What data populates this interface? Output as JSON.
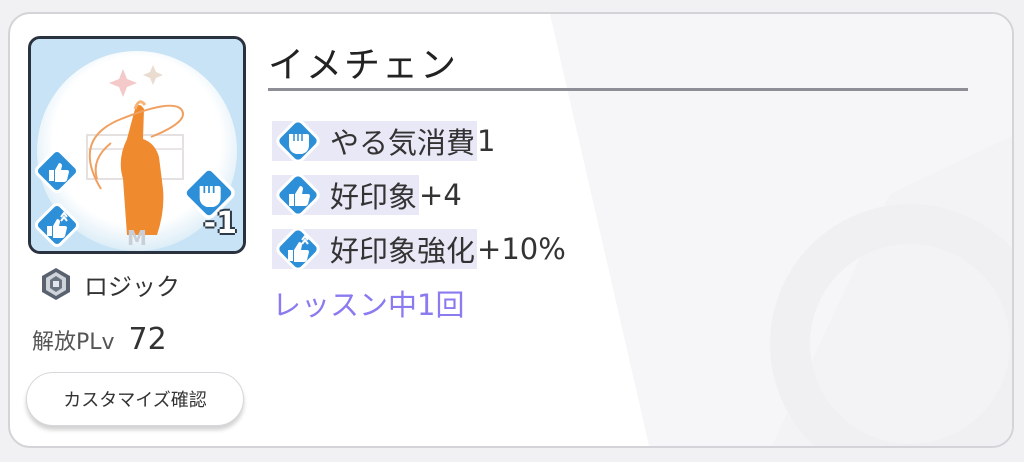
{
  "card": {
    "title": "イメチェン",
    "cost_badge": "-1",
    "plan_label": "ロジック",
    "plv_label": "解放PLv",
    "plv_value": "72",
    "customize_label": "カスタマイズ確認"
  },
  "effects": [
    {
      "icon": "fist-icon",
      "highlight": "やる気消費",
      "rest": "1"
    },
    {
      "icon": "thumbs-up-icon",
      "highlight": "好印象",
      "rest": "+4"
    },
    {
      "icon": "thumbs-up-boost-icon",
      "highlight": "好印象強化",
      "rest": "+10%"
    }
  ],
  "lesson_condition": "レッスン中1回",
  "colors": {
    "accent_purple": "#8a7bf0",
    "icon_blue": "#2d8fd8",
    "highlight_bg": "#e9e8f6",
    "rule": "#8e8e96"
  }
}
